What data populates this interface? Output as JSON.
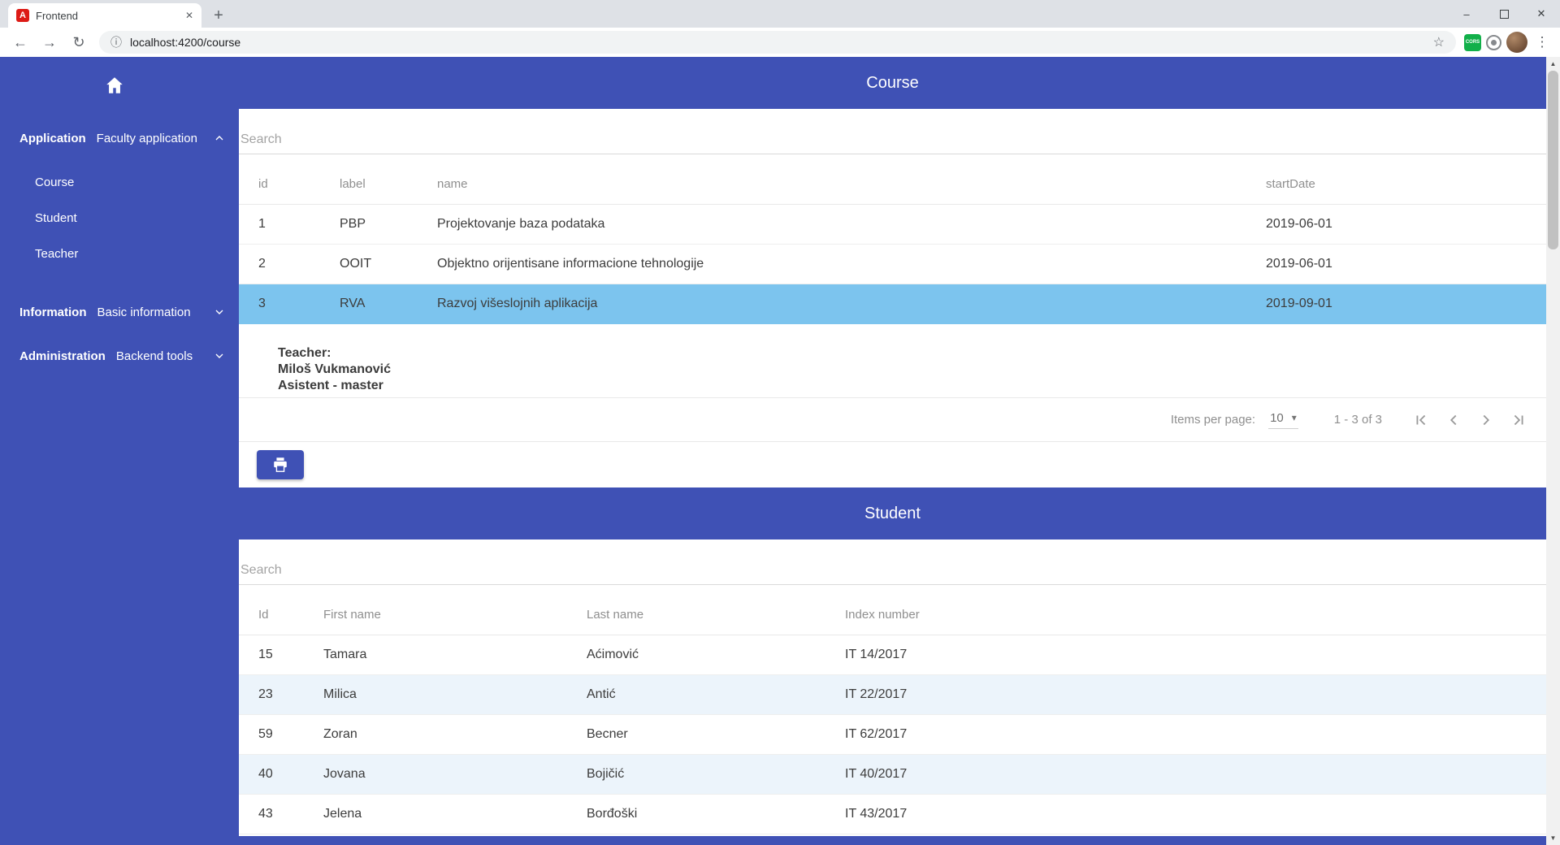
{
  "browser": {
    "tab_title": "Frontend",
    "url": "localhost:4200/course",
    "extension_badge": "CORS"
  },
  "icons": {
    "angular_logo_letter": "A",
    "tab_close": "✕",
    "new_tab": "+",
    "minimize": "–",
    "close": "✕",
    "back": "←",
    "forward": "→",
    "reload": "↻",
    "info": "ⓘ",
    "star": "☆",
    "menu_dots": "⋮",
    "scroll_up": "▲",
    "scroll_down": "▼",
    "select_arrow": "▾"
  },
  "sidebar": {
    "sections": [
      {
        "category": "Application",
        "title": "Faculty application",
        "expanded": true,
        "items": [
          {
            "label": "Course"
          },
          {
            "label": "Student"
          },
          {
            "label": "Teacher"
          }
        ]
      },
      {
        "category": "Information",
        "title": "Basic information",
        "expanded": false,
        "items": []
      },
      {
        "category": "Administration",
        "title": "Backend tools",
        "expanded": false,
        "items": []
      }
    ]
  },
  "course": {
    "title": "Course",
    "search_placeholder": "Search",
    "columns": [
      "id",
      "label",
      "name",
      "startDate"
    ],
    "rows": [
      {
        "id": "1",
        "label": "PBP",
        "name": "Projektovanje baza podataka",
        "startDate": "2019-06-01"
      },
      {
        "id": "2",
        "label": "OOIT",
        "name": "Objektno orijentisane informacione tehnologije",
        "startDate": "2019-06-01"
      },
      {
        "id": "3",
        "label": "RVA",
        "name": "Razvoj višeslojnih aplikacija",
        "startDate": "2019-09-01"
      }
    ],
    "detail": {
      "title": "Teacher:",
      "name": "Miloš Vukmanović",
      "role": "Asistent - master"
    },
    "paginator": {
      "label": "Items per page:",
      "page_size": "10",
      "range": "1 - 3 of 3"
    }
  },
  "student": {
    "title": "Student",
    "search_placeholder": "Search",
    "columns": [
      "Id",
      "First name",
      "Last name",
      "Index number"
    ],
    "rows": [
      {
        "id": "15",
        "first": "Tamara",
        "last": "Aćimović",
        "index": "IT 14/2017"
      },
      {
        "id": "23",
        "first": "Milica",
        "last": "Antić",
        "index": "IT 22/2017"
      },
      {
        "id": "59",
        "first": "Zoran",
        "last": "Becner",
        "index": "IT 62/2017"
      },
      {
        "id": "40",
        "first": "Jovana",
        "last": "Bojičić",
        "index": "IT 40/2017"
      },
      {
        "id": "43",
        "first": "Jelena",
        "last": "Borđoški",
        "index": "IT 43/2017"
      }
    ]
  },
  "colors": {
    "primary": "#3f51b5",
    "selected_row": "#7cc4ee",
    "row_alt": "#ecf4fb"
  }
}
